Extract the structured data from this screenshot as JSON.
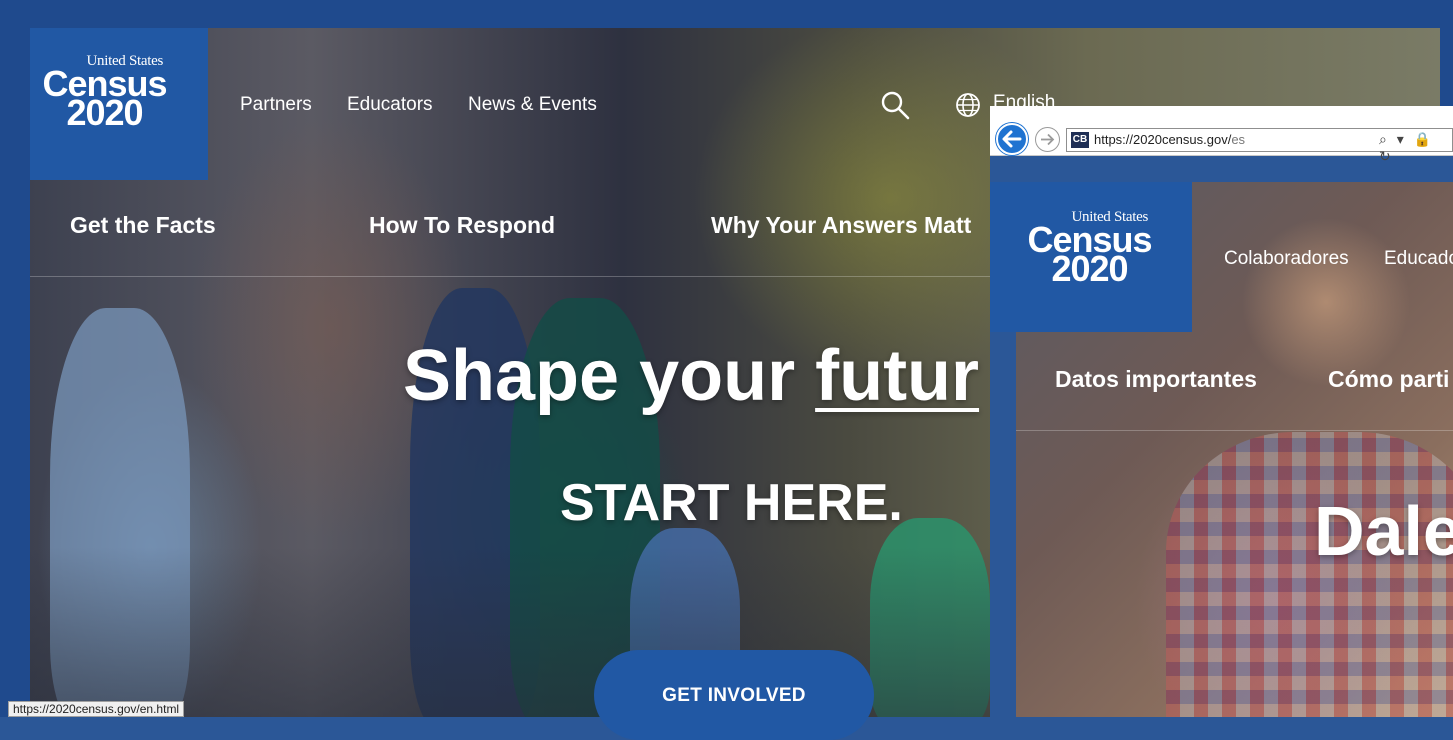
{
  "main": {
    "logo": {
      "line1": "United States",
      "line2": "Census",
      "line3": "2020"
    },
    "nav": [
      {
        "label": "Partners"
      },
      {
        "label": "Educators"
      },
      {
        "label": "News & Events"
      }
    ],
    "language": "English",
    "sections": [
      {
        "label": "Get the Facts"
      },
      {
        "label": "How To Respond"
      },
      {
        "label": "Why Your Answers Matt"
      }
    ],
    "headline_plain": "Shape your ",
    "headline_underlined": "futur",
    "subhead": "START HERE.",
    "cta_label": "GET INVOLVED",
    "status_url": "https://2020census.gov/en.html"
  },
  "overlay": {
    "site_badge": "CB",
    "url_host": "https://2020census.gov/",
    "url_path": "es",
    "address_tools": "⌕ ▾ 🔒 ↻",
    "logo": {
      "line1": "United States",
      "line2": "Census",
      "line3": "2020"
    },
    "nav": [
      {
        "label": "Colaboradores"
      },
      {
        "label": "Educado"
      }
    ],
    "sections": [
      {
        "label": "Datos importantes"
      },
      {
        "label": "Cómo parti"
      }
    ],
    "headline": "Dale"
  },
  "colors": {
    "frame_blue": "#2b5797",
    "logo_blue": "#2158a4",
    "back_button_blue": "#1f73d1"
  }
}
